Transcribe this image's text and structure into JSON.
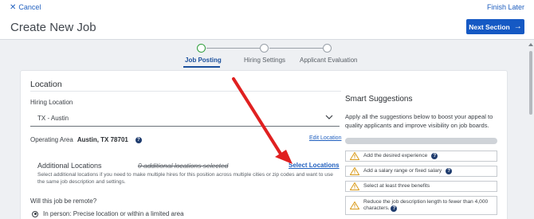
{
  "topbar": {
    "cancel_label": "Cancel",
    "finish_label": "Finish Later"
  },
  "header": {
    "title": "Create New Job",
    "next_label": "Next Section"
  },
  "stepper": {
    "steps": [
      {
        "label": "Job Posting",
        "active": true
      },
      {
        "label": "Hiring Settings",
        "active": false
      },
      {
        "label": "Applicant Evaluation",
        "active": false
      }
    ]
  },
  "location": {
    "section_title": "Location",
    "hiring_location_label": "Hiring Location",
    "hiring_location_value": "TX - Austin",
    "operating_area_label": "Operating Area",
    "operating_area_value": "Austin, TX 78701",
    "edit_location_label": "Edit Location",
    "additional_title": "Additional Locations",
    "additional_count": "0 additional locations selected",
    "select_locations_label": "Select Locations",
    "additional_desc": "Select additional locations if you need to make multiple hires for this position across multiple cities or zip codes and want to use the same job description and settings.",
    "remote_question": "Will this job be remote?",
    "remote_option_1": "In person: Precise location or within a limited area"
  },
  "smart": {
    "title": "Smart Suggestions",
    "description": "Apply all the suggestions below to boost your appeal to quality applicants and improve visibility on job boards.",
    "progress": 0,
    "items": [
      {
        "label": "Add the desired experience"
      },
      {
        "label": "Add a salary range or fixed salary"
      },
      {
        "label": "Select at least three benefits"
      },
      {
        "label": "Reduce the job description length to fewer than 4,000 characters."
      }
    ]
  },
  "colors": {
    "primary": "#1559c4",
    "link": "#1f5fbf",
    "step_active": "#2f9e3b",
    "warning": "#d89a1a",
    "annotation_arrow": "#e02020"
  },
  "icons": [
    "close-icon",
    "arrow-right-icon",
    "chevron-down-icon",
    "help-icon",
    "warning-icon"
  ]
}
